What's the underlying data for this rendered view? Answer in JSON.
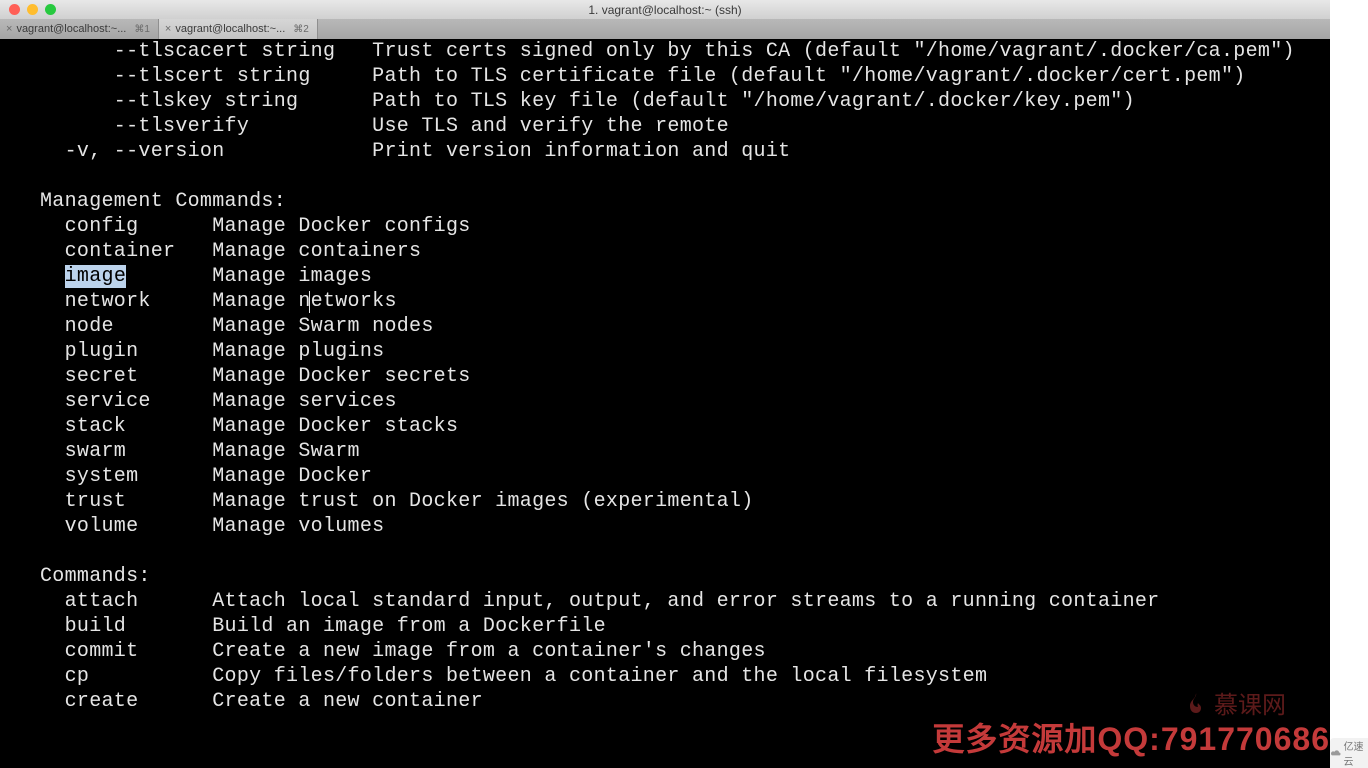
{
  "window": {
    "title": "1. vagrant@localhost:~ (ssh)"
  },
  "tabs": [
    {
      "label": "vagrant@localhost:~...",
      "shortcut": "⌘1",
      "active": false
    },
    {
      "label": "vagrant@localhost:~...",
      "shortcut": "⌘2",
      "active": true
    }
  ],
  "terminal": {
    "options": [
      {
        "flag": "    --tlscacert string",
        "desc": "Trust certs signed only by this CA (default \"/home/vagrant/.docker/ca.pem\")"
      },
      {
        "flag": "    --tlscert string",
        "desc": "Path to TLS certificate file (default \"/home/vagrant/.docker/cert.pem\")"
      },
      {
        "flag": "    --tlskey string",
        "desc": "Path to TLS key file (default \"/home/vagrant/.docker/key.pem\")"
      },
      {
        "flag": "    --tlsverify",
        "desc": "Use TLS and verify the remote"
      },
      {
        "flag": "-v, --version",
        "desc": "Print version information and quit"
      }
    ],
    "sections": {
      "management_header": "Management Commands:",
      "management": [
        {
          "cmd": "config",
          "desc": "Manage Docker configs"
        },
        {
          "cmd": "container",
          "desc": "Manage containers"
        },
        {
          "cmd": "image",
          "desc": "Manage images",
          "selected": true
        },
        {
          "cmd": "network",
          "desc": "Manage networks"
        },
        {
          "cmd": "node",
          "desc": "Manage Swarm nodes"
        },
        {
          "cmd": "plugin",
          "desc": "Manage plugins"
        },
        {
          "cmd": "secret",
          "desc": "Manage Docker secrets"
        },
        {
          "cmd": "service",
          "desc": "Manage services"
        },
        {
          "cmd": "stack",
          "desc": "Manage Docker stacks"
        },
        {
          "cmd": "swarm",
          "desc": "Manage Swarm"
        },
        {
          "cmd": "system",
          "desc": "Manage Docker"
        },
        {
          "cmd": "trust",
          "desc": "Manage trust on Docker images (experimental)"
        },
        {
          "cmd": "volume",
          "desc": "Manage volumes"
        }
      ],
      "commands_header": "Commands:",
      "commands": [
        {
          "cmd": "attach",
          "desc": "Attach local standard input, output, and error streams to a running container"
        },
        {
          "cmd": "build",
          "desc": "Build an image from a Dockerfile"
        },
        {
          "cmd": "commit",
          "desc": "Create a new image from a container's changes"
        },
        {
          "cmd": "cp",
          "desc": "Copy files/folders between a container and the local filesystem"
        },
        {
          "cmd": "create",
          "desc": "Create a new container"
        }
      ]
    }
  },
  "watermarks": {
    "imooc": "慕课网",
    "promo": "更多资源加QQ:791770686",
    "badge": "亿速云"
  },
  "colors": {
    "terminal_bg": "#000000",
    "terminal_fg": "#e5e5e5",
    "selection_bg": "#bcd3ec",
    "watermark": "#c43a3a"
  }
}
